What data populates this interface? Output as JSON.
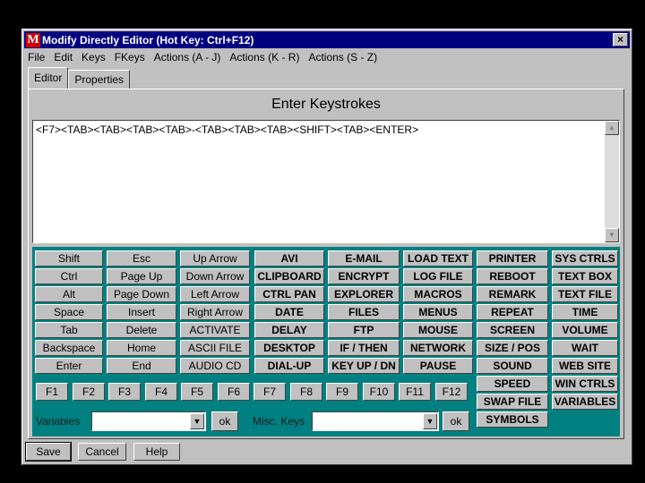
{
  "window": {
    "app_icon_letter": "M",
    "title": "Modify Directly Editor  (Hot Key: Ctrl+F12)",
    "close_symbol": "×"
  },
  "menu": [
    "File",
    "Edit",
    "Keys",
    "FKeys",
    "Actions (A - J)",
    "Actions (K - R)",
    "Actions (S - Z)"
  ],
  "tabs": [
    {
      "label": "Editor",
      "active": true
    },
    {
      "label": "Properties",
      "active": false
    }
  ],
  "editor": {
    "heading": "Enter Keystrokes",
    "text": "<F7><TAB><TAB><TAB><TAB>-<TAB><TAB><TAB><SHIFT><TAB><ENTER>"
  },
  "key_columns": [
    {
      "bold": false,
      "keys": [
        "Shift",
        "Ctrl",
        "Alt",
        "Space",
        "Tab",
        "Backspace",
        "Enter"
      ]
    },
    {
      "bold": false,
      "keys": [
        "Esc",
        "Page Up",
        "Page Down",
        "Insert",
        "Delete",
        "Home",
        "End"
      ]
    },
    {
      "bold": false,
      "keys": [
        "Up Arrow",
        "Down Arrow",
        "Left Arrow",
        "Right Arrow",
        "ACTIVATE",
        "ASCII FILE",
        "AUDIO CD"
      ]
    },
    {
      "bold": true,
      "keys": [
        "AVI",
        "CLIPBOARD",
        "CTRL PAN",
        "DATE",
        "DELAY",
        "DESKTOP",
        "DIAL-UP"
      ]
    },
    {
      "bold": true,
      "keys": [
        "E-MAIL",
        "ENCRYPT",
        "EXPLORER",
        "FILES",
        "FTP",
        "IF / THEN",
        "KEY UP / DN"
      ]
    },
    {
      "bold": true,
      "keys": [
        "LOAD TEXT",
        "LOG FILE",
        "MACROS",
        "MENUS",
        "MOUSE",
        "NETWORK",
        "PAUSE"
      ]
    },
    {
      "bold": true,
      "keys": [
        "PRINTER",
        "REBOOT",
        "REMARK",
        "REPEAT",
        "SCREEN",
        "SIZE / POS",
        "SOUND",
        "SPEED",
        "SWAP FILE",
        "SYMBOLS"
      ]
    },
    {
      "bold": true,
      "keys": [
        "SYS CTRLS",
        "TEXT BOX",
        "TEXT FILE",
        "TIME",
        "VOLUME",
        "WAIT",
        "WEB SITE",
        "WIN CTRLS",
        "VARIABLES"
      ]
    }
  ],
  "fkeys": [
    "F1",
    "F2",
    "F3",
    "F4",
    "F5",
    "F6",
    "F7",
    "F8",
    "F9",
    "F10",
    "F11",
    "F12"
  ],
  "variables": {
    "label": "Variables",
    "value": "",
    "ok": "ok"
  },
  "misc_keys": {
    "label": "Misc. Keys",
    "value": "",
    "ok": "ok"
  },
  "buttons": {
    "save": "Save",
    "cancel": "Cancel",
    "help": "Help"
  }
}
